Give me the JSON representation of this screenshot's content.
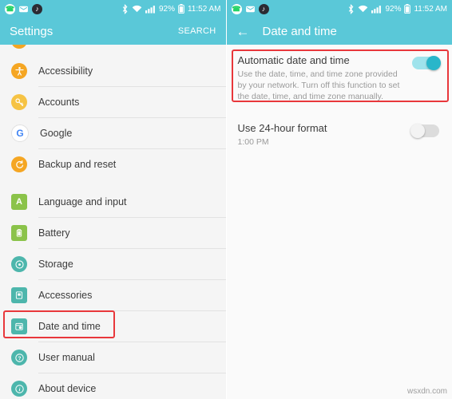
{
  "left": {
    "status_bar": {
      "icons": [
        "whatsapp-icon",
        "message-icon",
        "music-icon"
      ],
      "right_icons": [
        "bluetooth-icon",
        "wifi-icon",
        "signal-icon"
      ],
      "battery": "92%",
      "clock": "11:52 AM"
    },
    "app_bar": {
      "title": "Settings",
      "search_label": "SEARCH"
    },
    "items": [
      {
        "label": "Accessibility",
        "icon": "accessibility-icon",
        "color": "#f5a623",
        "glyph": "A"
      },
      {
        "label": "Accounts",
        "icon": "key-icon",
        "color": "#f5c242",
        "glyph": "⚷"
      },
      {
        "label": "Google",
        "icon": "google-icon",
        "color": "#ffffff",
        "glyph": "G"
      },
      {
        "label": "Backup and reset",
        "icon": "backup-icon",
        "color": "#f5a623",
        "glyph": "↻"
      },
      {
        "label": "Language and input",
        "icon": "language-icon",
        "color": "#8bc34a",
        "glyph": "A"
      },
      {
        "label": "Battery",
        "icon": "battery-icon",
        "color": "#8bc34a",
        "glyph": "▮"
      },
      {
        "label": "Storage",
        "icon": "storage-icon",
        "color": "#4db6ac",
        "glyph": "◎"
      },
      {
        "label": "Accessories",
        "icon": "accessories-icon",
        "color": "#4db6ac",
        "glyph": "▣"
      },
      {
        "label": "Date and time",
        "icon": "date-time-icon",
        "color": "#4db6ac",
        "glyph": "⏱"
      },
      {
        "label": "User manual",
        "icon": "user-manual-icon",
        "color": "#4db6ac",
        "glyph": "?"
      },
      {
        "label": "About device",
        "icon": "about-device-icon",
        "color": "#4db6ac",
        "glyph": "i"
      }
    ],
    "highlight_item": "Date and time"
  },
  "right": {
    "status_bar": {
      "icons": [
        "whatsapp-icon",
        "message-icon",
        "music-icon"
      ],
      "right_icons": [
        "bluetooth-icon",
        "wifi-icon",
        "signal-icon"
      ],
      "battery": "92%",
      "clock": "11:52 AM"
    },
    "app_bar": {
      "back_icon": "back-arrow-icon",
      "title": "Date and time"
    },
    "prefs": [
      {
        "title": "Automatic date and time",
        "subtitle": "Use the date, time, and time zone provided by your network. Turn off this function to set the date, time, and time zone manually.",
        "toggle": "on",
        "highlighted": true
      },
      {
        "title": "Use 24-hour format",
        "subtitle": "1:00 PM",
        "toggle": "off",
        "highlighted": false
      }
    ]
  },
  "watermark": "wsxdn.com",
  "colors": {
    "accent": "#5ac8d8",
    "highlight": "#e8373b",
    "toggle_on": "#29b6ca"
  }
}
